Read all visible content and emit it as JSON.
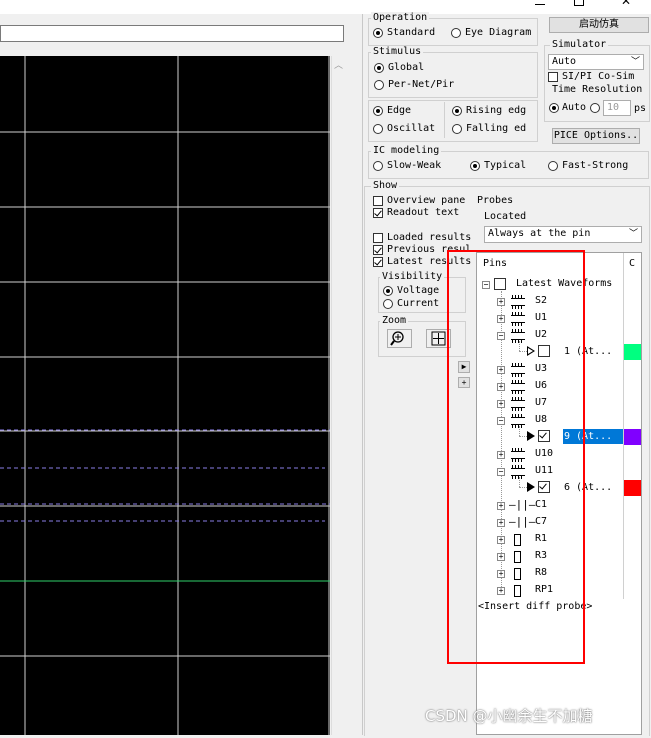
{
  "operation": {
    "title": "Operation",
    "standard": "Standard",
    "eye": "Eye Diagram"
  },
  "simulate_button": "启动仿真",
  "stimulus": {
    "title": "Stimulus",
    "global": "Global",
    "per_net": "Per-Net/Pir"
  },
  "simulator": {
    "title": "Simulator",
    "value": "Auto",
    "cosim": "SI/PI Co-Sim"
  },
  "time_resolution": {
    "title": "Time Resolution",
    "auto": "Auto",
    "value": "10",
    "unit": "ps"
  },
  "edge": {
    "edge": "Edge",
    "oscillate": "Oscillat",
    "rising": "Rising edg",
    "falling": "Falling ed"
  },
  "spice_options_button": "PICE Options..",
  "ic_modeling": {
    "title": "IC modeling",
    "slow": "Slow-Weak",
    "typical": "Typical",
    "fast": "Fast-Strong"
  },
  "show": {
    "title": "Show",
    "overview": "Overview pane",
    "readout": "Readout text",
    "loaded": "Loaded results",
    "previous": "Previous resul",
    "latest": "Latest results"
  },
  "probes": {
    "title": "Probes",
    "located_label": "Located",
    "located_value": "Always at the pin",
    "col_pins": "Pins",
    "col_c": "C"
  },
  "visibility": {
    "title": "Visibility",
    "voltage": "Voltage",
    "current": "Current"
  },
  "zoom": {
    "title": "Zoom"
  },
  "tree": {
    "root": "Latest Waveforms",
    "items": [
      {
        "label": "S2"
      },
      {
        "label": "U1"
      },
      {
        "label": "U2"
      },
      {
        "label": "1 (At..."
      },
      {
        "label": "U3"
      },
      {
        "label": "U6"
      },
      {
        "label": "U7"
      },
      {
        "label": "U8"
      },
      {
        "label": "9 (At..."
      },
      {
        "label": "U10"
      },
      {
        "label": "U11"
      },
      {
        "label": "6 (At..."
      },
      {
        "label": "C1"
      },
      {
        "label": "C7"
      },
      {
        "label": "R1"
      },
      {
        "label": "R3"
      },
      {
        "label": "R8"
      },
      {
        "label": "RP1"
      }
    ],
    "insert": "<Insert diff probe>"
  },
  "colors": {
    "pin1": "#00ff80",
    "pin9": "#8000ff",
    "pin6": "#ff0000",
    "highlight": "#ff0000",
    "selected": "#0078d7"
  },
  "watermark": "CSDN @小幽余生不加糖"
}
